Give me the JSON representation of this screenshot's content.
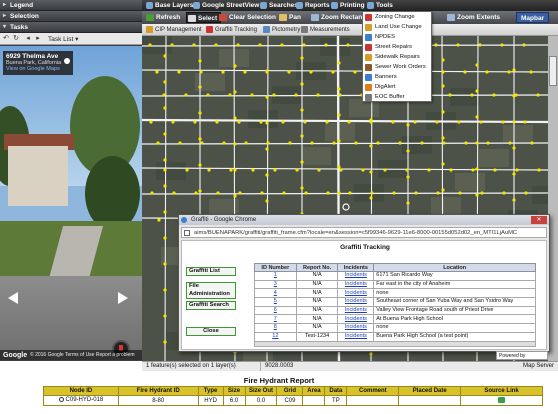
{
  "left_panel": {
    "legend": "Legend",
    "selection": "Selection",
    "tasks": "Tasks",
    "task_list": "Task List",
    "streetview": {
      "address": "6929 Thelma Ave",
      "city": "Buena Park, California",
      "maps_link": "View on Google Maps",
      "footer": "© 2016 Google   Terms of Use   Report a problem",
      "logo": "Google"
    }
  },
  "menu": {
    "base_layers": "Base Layers",
    "streetview": "Google StreetView",
    "searches": "Searches",
    "reports": "Reports",
    "printing": "Printing",
    "tools": "Tools"
  },
  "toolbar": {
    "refresh": "Refresh",
    "select": "Select",
    "clear_selection": "Clear Selection",
    "pan": "Pan",
    "zoom_rectangle": "Zoom Rectang",
    "zoom_extents": "Zoom Extents",
    "mapbar": "Mapbar"
  },
  "toolbar2": {
    "cip": "CIP Management",
    "graffiti": "Graffiti Tracking",
    "pictometry": "Pictometry",
    "measurements": "Measurements"
  },
  "tools_menu": [
    "Zoning Change",
    "Land Use Change",
    "NPDES",
    "Street Repairs",
    "Sidewalk Repairs",
    "Sewer Work Orders",
    "Banners",
    "DigAlert",
    "EOC Buffer"
  ],
  "dialog": {
    "title": "Graffiti - Google Chrome",
    "url": "aims/BUENAPARK/graffiti/graffiti_frame.cfm?locale=en&session=c5f99346-9629-11e6-8000-00155d052d02_en_MTI1LjAuMC",
    "heading": "Graffiti Tracking",
    "buttons": {
      "list": "Graffiti List",
      "admin": "File Administration",
      "search": "Graffiti Search",
      "close": "Close"
    },
    "columns": [
      "ID Number",
      "Report No.",
      "Incidents",
      "Location"
    ],
    "rows": [
      [
        "1",
        "N/A",
        "Incidents",
        "6171 San Ricardo Way"
      ],
      [
        "3",
        "N/A",
        "Incidents",
        "Far east in the city of Anaheim"
      ],
      [
        "4",
        "N/A",
        "Incidents",
        "none"
      ],
      [
        "5",
        "N/A",
        "Incidents",
        "Southeast corner of San Yuba Way and San Ysidro Way"
      ],
      [
        "6",
        "N/A",
        "Incidents",
        "Valley View Frontage Road south of Priest Drive"
      ],
      [
        "7",
        "N/A",
        "Incidents",
        "At Buena Park High School"
      ],
      [
        "8",
        "N/A",
        "Incidents",
        "none"
      ],
      [
        "12",
        "Test-1234",
        "Incidents",
        "Buena Park High School (a test point)"
      ]
    ]
  },
  "status": {
    "selected": "1 feature(s) selected on 1 layer(s)",
    "coords": "9028.0003",
    "scale": "Map Server",
    "powered": "Powered by"
  },
  "report": {
    "title": "Fire Hydrant Report",
    "columns": [
      "Node ID",
      "Fire Hydrant ID",
      "Type",
      "Size",
      "Size Out",
      "Grid",
      "Area",
      "Data",
      "Comment",
      "Placed Date",
      "Source Link"
    ],
    "rows": [
      [
        "C09-HYD-018",
        "8-80",
        "HYD",
        "6.0",
        "0.0",
        "C09",
        "",
        "TP",
        "",
        "",
        ""
      ]
    ]
  },
  "colors": {
    "map_bg": "#4c5248",
    "street": "#f2f2f2",
    "hydrant": "#f5e400",
    "report_header": "#d8c22c",
    "button_border": "#3b9a2d"
  }
}
